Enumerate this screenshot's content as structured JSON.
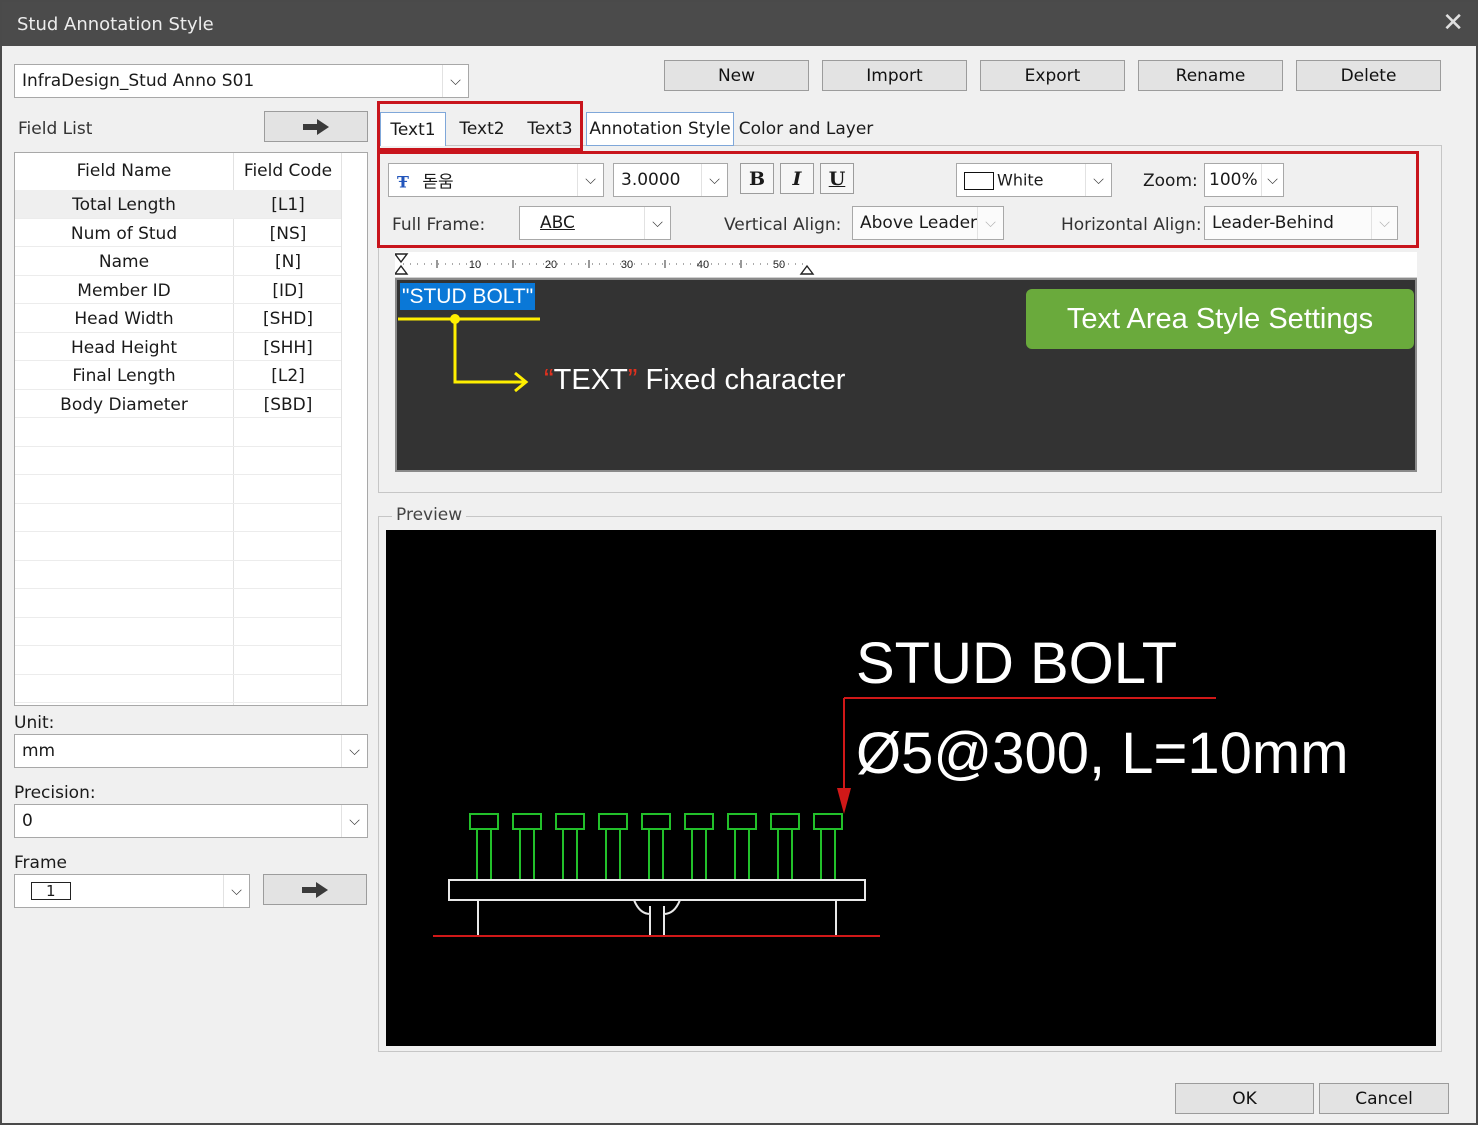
{
  "window": {
    "title": "Stud Annotation Style",
    "close_glyph": "✕"
  },
  "style_select": {
    "value": "InfraDesign_Stud Anno S01"
  },
  "toolbar": {
    "new": "New",
    "import": "Import",
    "export": "Export",
    "rename": "Rename",
    "delete": "Delete"
  },
  "field_list": {
    "label": "Field List",
    "col_name": "Field Name",
    "col_code": "Field Code",
    "rows": [
      {
        "name": "Total Length",
        "code": "[L1]"
      },
      {
        "name": "Num of Stud",
        "code": "[NS]"
      },
      {
        "name": "Name",
        "code": "[N]"
      },
      {
        "name": "Member ID",
        "code": "[ID]"
      },
      {
        "name": "Head Width",
        "code": "[SHD]"
      },
      {
        "name": "Head Height",
        "code": "[SHH]"
      },
      {
        "name": "Final Length",
        "code": "[L2]"
      },
      {
        "name": "Body Diameter",
        "code": "[SBD]"
      }
    ]
  },
  "unit": {
    "label": "Unit:",
    "value": "mm"
  },
  "precision": {
    "label": "Precision:",
    "value": "0"
  },
  "frame": {
    "label": "Frame",
    "value": "1"
  },
  "tabs": {
    "text1": "Text1",
    "text2": "Text2",
    "text3": "Text3",
    "annotation_style": "Annotation Style",
    "color_layer": "Color and Layer"
  },
  "text_style": {
    "font": "돋움",
    "height": "3.0000",
    "bold": "B",
    "italic": "I",
    "underline": "U",
    "color": "White",
    "zoom_label": "Zoom:",
    "zoom": "100%",
    "full_frame_label": "Full Frame:",
    "full_frame": "ABC",
    "vertical_align_label": "Vertical Align:",
    "vertical_align": "Above Leader",
    "horizontal_align_label": "Horizontal Align:",
    "horizontal_align": "Leader-Behind"
  },
  "ruler": {
    "ticks": [
      "10",
      "20",
      "30",
      "40",
      "50"
    ]
  },
  "editor": {
    "selected_text": "\"STUD BOLT\"",
    "callout": "Text Area Style Settings",
    "fixed_q1": "“",
    "fixed_text": "TEXT",
    "fixed_q2": "”",
    "fixed_rest": " Fixed character"
  },
  "preview": {
    "label": "Preview",
    "line1": "STUD BOLT",
    "line2": "Ø5@300, L=10mm"
  },
  "footer": {
    "ok": "OK",
    "cancel": "Cancel"
  },
  "colors": {
    "accent_red": "#c8141c",
    "callout_green": "#6aaa3c",
    "selection_blue": "#0a78d7",
    "stud_green": "#22c02a",
    "leader_red": "#d01818"
  }
}
